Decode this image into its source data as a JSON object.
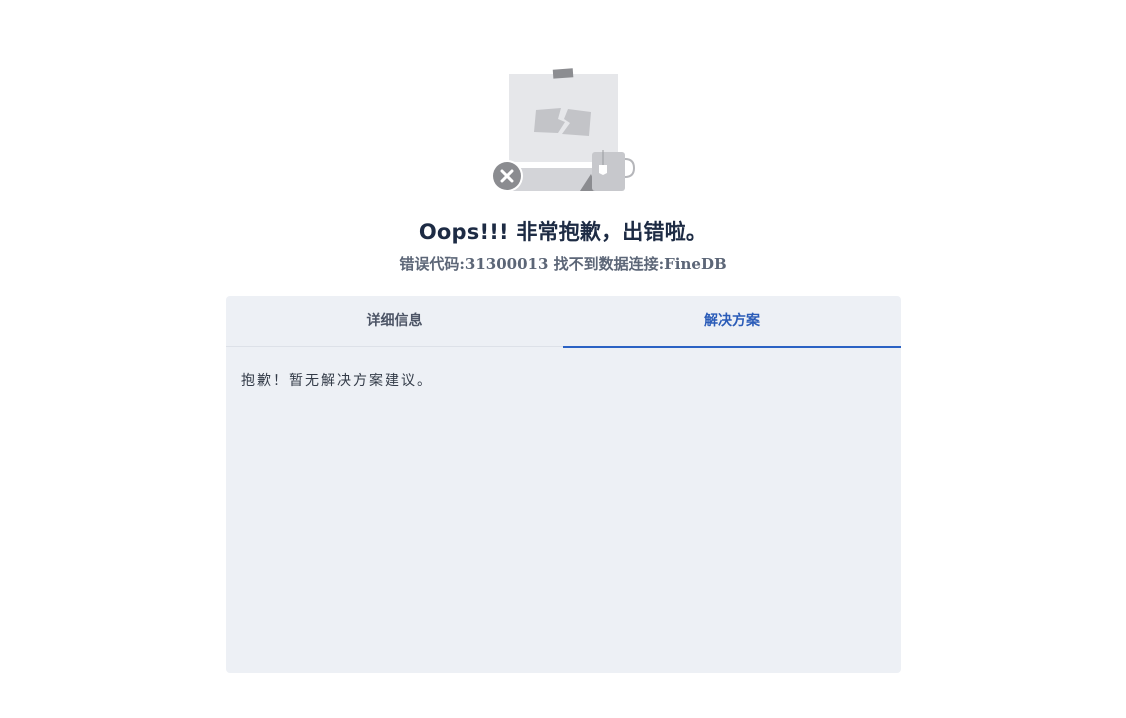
{
  "error": {
    "title": "Oops!!! 非常抱歉，出错啦。",
    "subtitle": "错误代码:31300013 找不到数据连接:FineDB"
  },
  "tabs": [
    {
      "label": "详细信息",
      "active": false
    },
    {
      "label": "解决方案",
      "active": true
    }
  ],
  "content": {
    "text": "抱歉！暂无解决方案建议。"
  },
  "colors": {
    "accent": "#2b62c4",
    "panel_bg": "#edf0f5",
    "title": "#1d2b44",
    "subtitle": "#5c6677"
  },
  "icons": {
    "illustration": "broken-picture-illustration",
    "error_badge": "close-icon"
  }
}
